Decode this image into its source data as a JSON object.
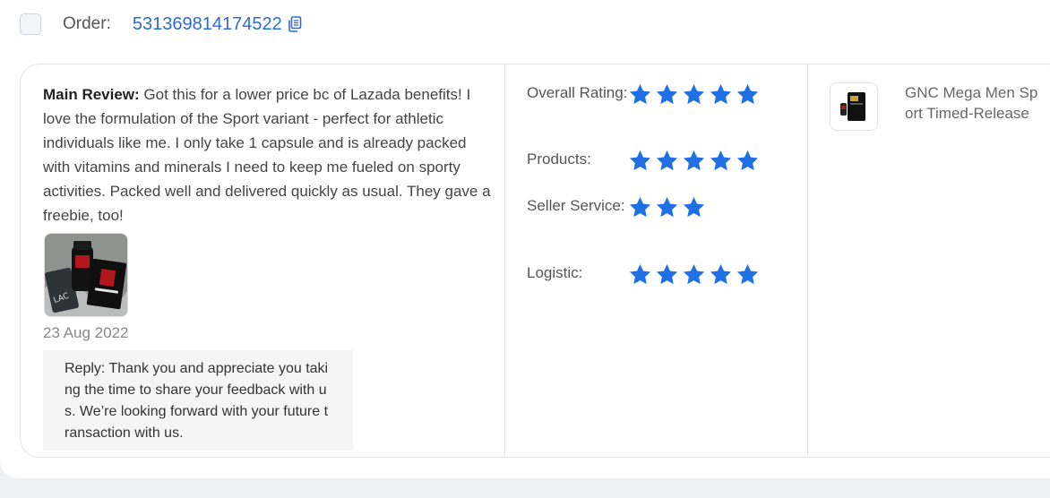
{
  "order": {
    "label": "Order:",
    "number": "531369814174522"
  },
  "review": {
    "main_label": "Main Review:",
    "text": " Got this for a lower price bc of Lazada benefits! I love the formulation of the Sport variant - perfect for athletic individuals like me. I only take 1 capsule and is already packed with vitamins and minerals I need to keep me fueled on sporty activities. Packed well and delivered quickly as usual. They gave a freebie, too!",
    "date": "23 Aug 2022",
    "reply": "Reply: Thank you and appreciate you taking the time to share your feedback with us. We’re looking forward with your future transaction with us."
  },
  "ratings": [
    {
      "label": "Overall Rating:",
      "stars": 5
    },
    {
      "label": "Products:",
      "stars": 5
    },
    {
      "label": "Seller Service:",
      "stars": 3
    },
    {
      "label": "Logistic:",
      "stars": 5
    }
  ],
  "product": {
    "name": "GNC Mega Men Sport Timed-Release"
  },
  "colors": {
    "star": "#1f6fe5",
    "link": "#2a6bd6"
  },
  "icons": {
    "copy": "copy-icon",
    "star": "star-icon"
  }
}
